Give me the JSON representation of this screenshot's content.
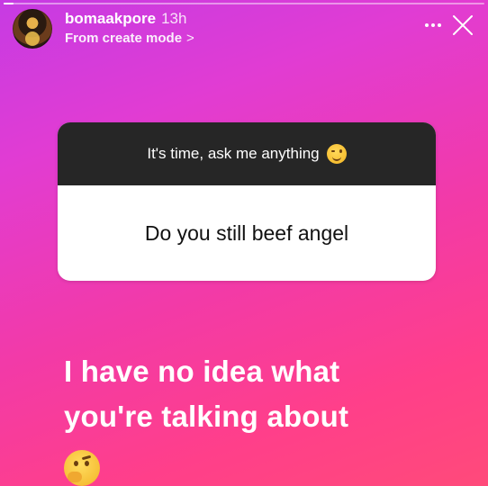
{
  "story": {
    "progress_fraction": 0.02,
    "username": "bomaakpore",
    "time_ago": "13h",
    "subtitle": "From create mode",
    "subtitle_chevron": ">",
    "icons": {
      "avatar": "profile-avatar",
      "more": "more-options-icon",
      "close": "close-icon"
    }
  },
  "question_card": {
    "prompt": "It's time, ask me anything",
    "prompt_emoji": "winking-face-emoji",
    "question": "Do you still beef angel"
  },
  "reply": {
    "line1": "I have no idea what",
    "line2": "you're talking about",
    "emoji": "thinking-face-emoji"
  },
  "colors": {
    "gradient_start": "#c63be3",
    "gradient_end": "#ff4a7a",
    "card_header_bg": "#262626",
    "card_body_bg": "#ffffff"
  }
}
